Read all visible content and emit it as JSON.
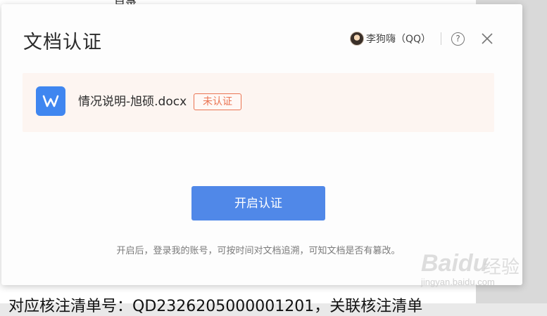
{
  "background_document": {
    "top_text": "目录",
    "bottom_text": "对应核注清单号：QD2326205000001201，关联核注清单"
  },
  "dialog": {
    "title": "文档认证",
    "user_name": "李狗嗨（QQ）",
    "help_label": "?",
    "file": {
      "name": "情况说明-旭硕.docx",
      "status": "未认证",
      "icon": "wps-writer-icon"
    },
    "primary_button": "开启认证",
    "footer_note": "开启后，登录我的账号，可按时间对文档追溯，可知文档是否有篡改。"
  },
  "watermark": {
    "brand": "Baidu",
    "brand_cn": "经验",
    "url": "jingyan.baidu.com"
  },
  "colors": {
    "accent": "#5088e8",
    "status": "#ea7452",
    "file_icon": "#3f86f0",
    "card_bg": "#fdf5f1"
  }
}
